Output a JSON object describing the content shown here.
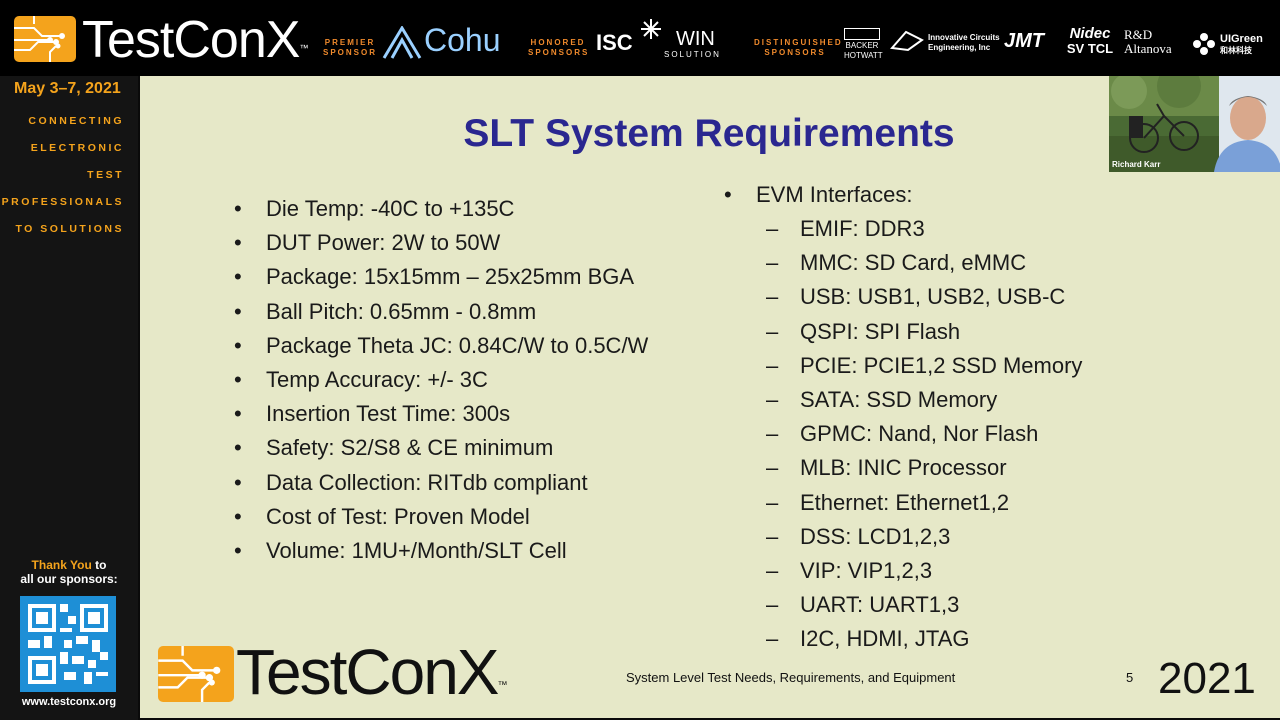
{
  "banner": {
    "logo_text": "TestConX",
    "logo_tm": "™",
    "premier_label_1": "PREMIER",
    "premier_label_2": "SPONSOR",
    "premier_sponsor": "Cohu",
    "honored_label_1": "HONORED",
    "honored_label_2": "SPONSORS",
    "honored_sponsors": [
      "ISC",
      "WIN",
      "SOLUTION"
    ],
    "distinguished_label_1": "DISTINGUISHED",
    "distinguished_label_2": "SPONSORS",
    "distinguished_sponsors": [
      "BACKER",
      "HOTWATT",
      "Innovative Circuits",
      "Engineering, Inc",
      "JMT",
      "Nidec",
      "SV TCL",
      "R&D",
      "Altanova",
      "UIGreen",
      "和林科技"
    ]
  },
  "sidebar": {
    "date": "May 3–7, 2021",
    "tagline": [
      "CONNECTING",
      "ELECTRONIC",
      "TEST",
      "PROFESSIONALS",
      "TO SOLUTIONS"
    ],
    "thanks_highlight": "Thank You",
    "thanks_rest_1": " to",
    "thanks_rest_2": "all our sponsors:",
    "website": "www.testconx.org"
  },
  "webcam": {
    "name": "Richard Karr"
  },
  "slide": {
    "title": "SLT System Requirements",
    "left_items": [
      "Die Temp: -40C to +135C",
      "DUT Power: 2W to 50W",
      "Package: 15x15mm – 25x25mm BGA",
      "Ball Pitch: 0.65mm - 0.8mm",
      "Package Theta JC:  0.84C/W to 0.5C/W",
      "Temp Accuracy: +/- 3C",
      "Insertion Test Time: 300s",
      "Safety: S2/S8 & CE minimum",
      "Data Collection: RITdb compliant",
      "Cost of Test: Proven Model",
      "Volume: 1MU+/Month/SLT Cell"
    ],
    "right_heading": "EVM Interfaces:",
    "right_items": [
      "EMIF: DDR3",
      "MMC: SD Card, eMMC",
      "USB: USB1, USB2, USB-C",
      "QSPI: SPI Flash",
      "PCIE: PCIE1,2 SSD Memory",
      "SATA: SSD Memory",
      "GPMC: Nand, Nor Flash",
      "MLB: INIC Processor",
      "Ethernet: Ethernet1,2",
      "DSS: LCD1,2,3",
      "VIP: VIP1,2,3",
      "UART: UART1,3",
      "I2C, HDMI, JTAG"
    ],
    "footer_logo": "TestConX",
    "footer_tm": "™",
    "footer_caption": "System Level Test Needs, Requirements, and Equipment",
    "page_number": "5",
    "year": "2021"
  },
  "colors": {
    "accent_orange": "#f4a31c",
    "slide_background": "#e6e8c8",
    "title_blue": "#2a2790"
  }
}
